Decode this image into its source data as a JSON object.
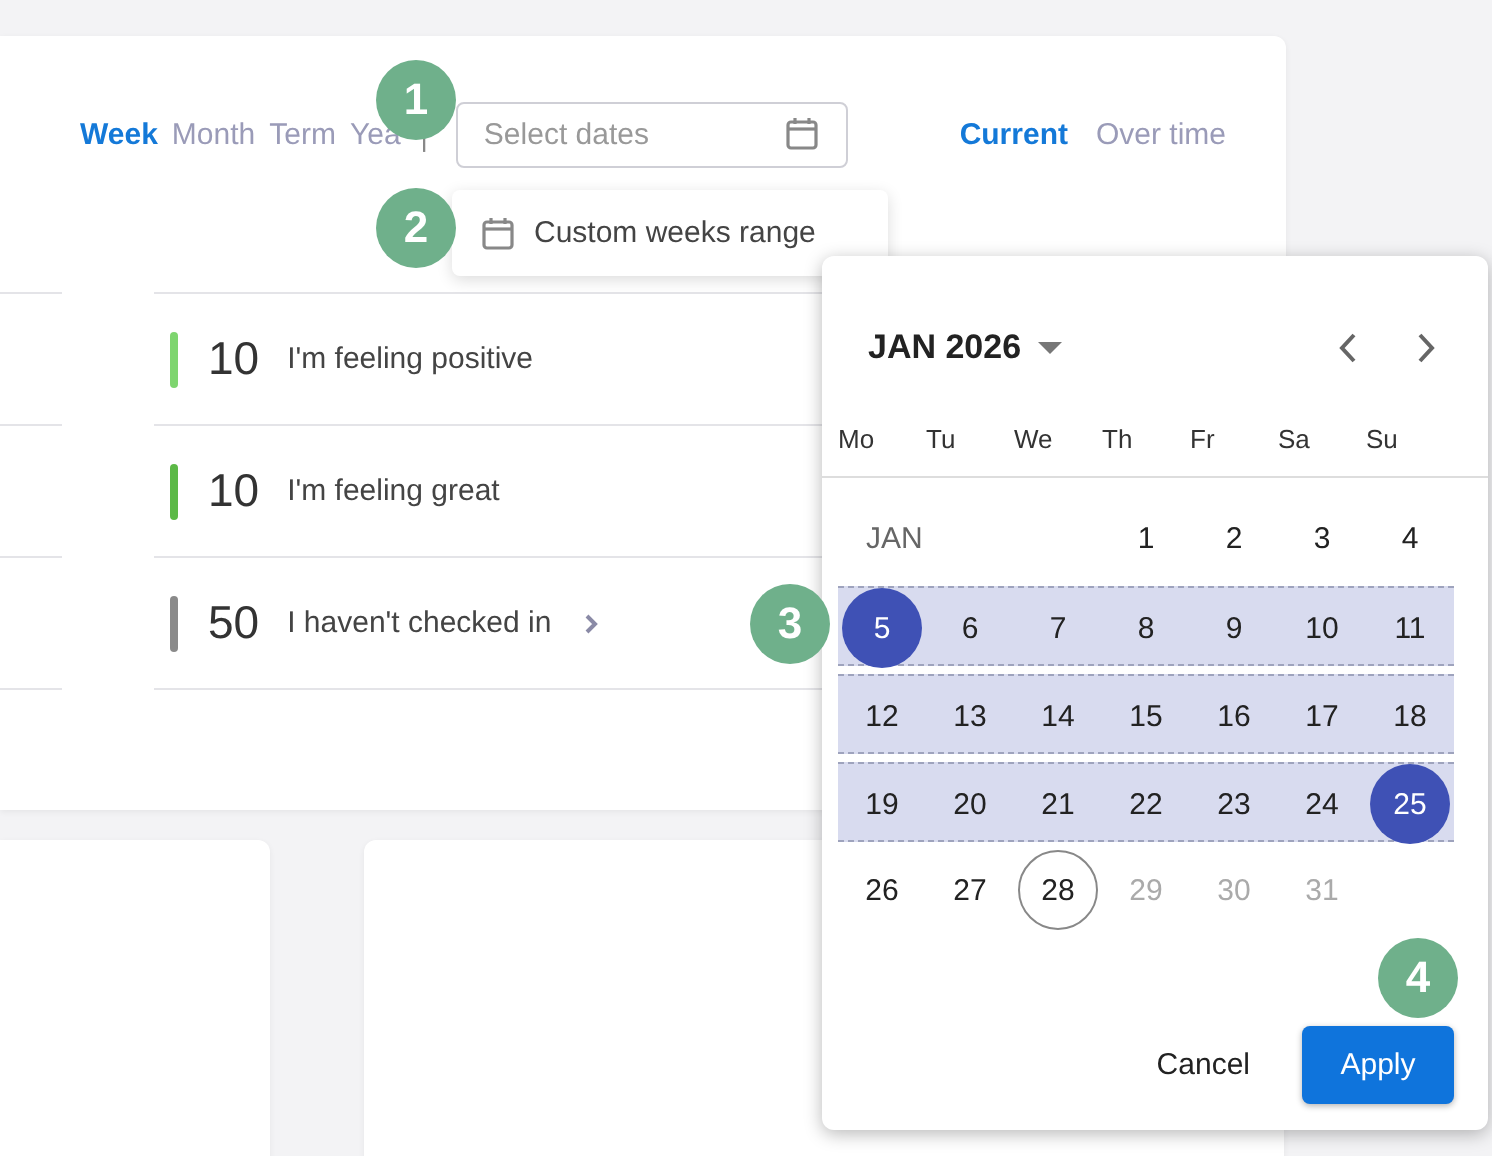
{
  "period_tabs": [
    {
      "label": "Week",
      "selected": true
    },
    {
      "label": "Month",
      "selected": false
    },
    {
      "label": "Term",
      "selected": false
    },
    {
      "label": "Yea",
      "selected": false
    }
  ],
  "separator": "|",
  "date_field": {
    "placeholder": "Select dates"
  },
  "view_tabs": [
    {
      "label": "Current",
      "selected": true
    },
    {
      "label": "Over time",
      "selected": false
    }
  ],
  "date_menu": {
    "items": [
      {
        "label": "Custom weeks range"
      }
    ]
  },
  "mood_rows": [
    {
      "count": "10",
      "label": "I'm feeling positive",
      "color": "#7ed56f",
      "chevron": false
    },
    {
      "count": "10",
      "label": "I'm feeling great",
      "color": "#5cb947",
      "chevron": false
    },
    {
      "count": "50",
      "label": "I haven't checked in",
      "color": "#8a8a8a",
      "chevron": true
    }
  ],
  "calendar": {
    "month": "JAN 2026",
    "weekdays": [
      "Mo",
      "Tu",
      "We",
      "Th",
      "Fr",
      "Sa",
      "Su"
    ],
    "month_short": "JAN",
    "weeks": [
      {
        "in_range": false,
        "days": [
          {
            "day": "1",
            "selected": false,
            "today": false,
            "disabled": false
          },
          {
            "day": "2",
            "selected": false,
            "today": false,
            "disabled": false
          },
          {
            "day": "3",
            "selected": false,
            "today": false,
            "disabled": false
          },
          {
            "day": "4",
            "selected": false,
            "today": false,
            "disabled": false
          }
        ]
      },
      {
        "in_range": true,
        "days": [
          {
            "day": "5",
            "selected": true,
            "today": false,
            "disabled": false
          },
          {
            "day": "6",
            "selected": false,
            "today": false,
            "disabled": false
          },
          {
            "day": "7",
            "selected": false,
            "today": false,
            "disabled": false
          },
          {
            "day": "8",
            "selected": false,
            "today": false,
            "disabled": false
          },
          {
            "day": "9",
            "selected": false,
            "today": false,
            "disabled": false
          },
          {
            "day": "10",
            "selected": false,
            "today": false,
            "disabled": false
          },
          {
            "day": "11",
            "selected": false,
            "today": false,
            "disabled": false
          }
        ]
      },
      {
        "in_range": true,
        "days": [
          {
            "day": "12",
            "selected": false,
            "today": false,
            "disabled": false
          },
          {
            "day": "13",
            "selected": false,
            "today": false,
            "disabled": false
          },
          {
            "day": "14",
            "selected": false,
            "today": false,
            "disabled": false
          },
          {
            "day": "15",
            "selected": false,
            "today": false,
            "disabled": false
          },
          {
            "day": "16",
            "selected": false,
            "today": false,
            "disabled": false
          },
          {
            "day": "17",
            "selected": false,
            "today": false,
            "disabled": false
          },
          {
            "day": "18",
            "selected": false,
            "today": false,
            "disabled": false
          }
        ]
      },
      {
        "in_range": true,
        "days": [
          {
            "day": "19",
            "selected": false,
            "today": false,
            "disabled": false
          },
          {
            "day": "20",
            "selected": false,
            "today": false,
            "disabled": false
          },
          {
            "day": "21",
            "selected": false,
            "today": false,
            "disabled": false
          },
          {
            "day": "22",
            "selected": false,
            "today": false,
            "disabled": false
          },
          {
            "day": "23",
            "selected": false,
            "today": false,
            "disabled": false
          },
          {
            "day": "24",
            "selected": false,
            "today": false,
            "disabled": false
          },
          {
            "day": "25",
            "selected": true,
            "today": false,
            "disabled": false
          }
        ]
      },
      {
        "in_range": false,
        "days": [
          {
            "day": "26",
            "selected": false,
            "today": false,
            "disabled": false
          },
          {
            "day": "27",
            "selected": false,
            "today": false,
            "disabled": false
          },
          {
            "day": "28",
            "selected": false,
            "today": true,
            "disabled": false
          },
          {
            "day": "29",
            "selected": false,
            "today": false,
            "disabled": true
          },
          {
            "day": "30",
            "selected": false,
            "today": false,
            "disabled": true
          },
          {
            "day": "31",
            "selected": false,
            "today": false,
            "disabled": true
          }
        ]
      }
    ],
    "cancel": "Cancel",
    "apply": "Apply"
  },
  "callouts": [
    {
      "number": "1"
    },
    {
      "number": "2"
    },
    {
      "number": "3"
    },
    {
      "number": "4"
    }
  ]
}
